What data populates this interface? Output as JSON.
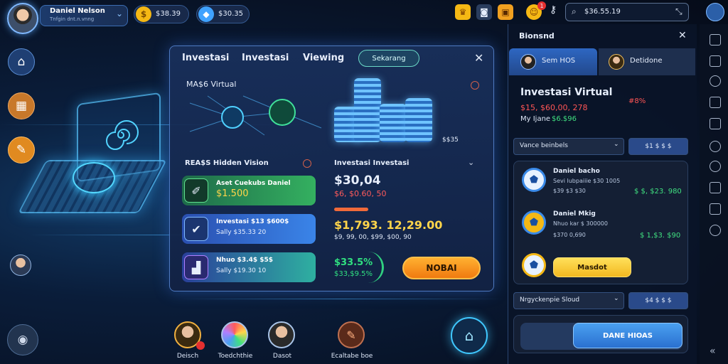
{
  "profile": {
    "name": "Daniel Nelson",
    "subtitle": "Tnfgin dnt.n.vnng",
    "avatar": "user-avatar"
  },
  "currency": {
    "gold": "$38.39",
    "gem": "$30.35"
  },
  "top_icons": [
    "trophy-icon",
    "camera-icon",
    "gift-icon",
    "notification-icon"
  ],
  "notification_badge": "1",
  "search": {
    "value": "$36.55.19"
  },
  "modal": {
    "tabs": [
      "Investasi",
      "Investasi",
      "Viewing"
    ],
    "active_tab": "Sekarang",
    "section_title": "MA$6 Virtual",
    "left_header": "REA$S Hidden Vision",
    "right_header": "Investasi Investasi",
    "cards": [
      {
        "title": "Aset Cuekubs Daniel",
        "sub": "$1.500",
        "icon": "wallet-icon"
      },
      {
        "title": "Investasi $13 $600$",
        "sub": "Sally $35.33 20",
        "icon": "shield-icon"
      },
      {
        "title": "Nhuo $3.4$ $5$",
        "sub": "Sally $19.30 10",
        "icon": "chart-icon"
      }
    ],
    "value_main": "$30,04",
    "value_sub": "$6, $0.60, 50",
    "value_big": "$1,793. 12,29.00",
    "value_big_sub": "$9, 99, 00, $99, $00, 90",
    "percent": "$33.5%",
    "percent_sub": "$33,$9.5%",
    "stack_label": "$$35",
    "buy_button": "NOBAI"
  },
  "right_panel": {
    "header": "Bionsnd",
    "tab_active": "Sem HOS",
    "tab_inactive": "Detidone",
    "title": "Investasi Virtual",
    "value": "$15, $60,00, 278",
    "value_badge": "#8%",
    "my_line": "My Ijane",
    "my_value": "$6.$96",
    "dropdown1": "Vance beinbels",
    "dropdown1_btn": "$1 $ $ $",
    "list": [
      {
        "title": "Daniel bacho",
        "sub": "Sevi lubpaiiie $30 1005",
        "date": "$39 $3 $30",
        "amount": "$ $, $23. 980",
        "icon": "shield-icon"
      },
      {
        "title": "Daniel Mkig",
        "sub": "Nhuo kar $ 300000",
        "date": "$370 0,690",
        "amount": "$ 1,$3. $90",
        "icon": "badge-icon"
      },
      {
        "title": "",
        "sub": "",
        "date": "",
        "amount": "",
        "icon": "shield-icon"
      }
    ],
    "list_button": "Masdot",
    "dropdown2": "Nrgyckenpie Sloud",
    "dropdown2_btn": "$4 $ $ $",
    "bottom_button": "DANE HIOAS"
  },
  "bottom_bar": [
    {
      "label": "Deisch"
    },
    {
      "label": "Toedchthie"
    },
    {
      "label": "Dasot"
    },
    {
      "label": "Ecaltabe boe"
    }
  ],
  "colors": {
    "accent": "#3b82f6",
    "positive": "#22e06b",
    "negative": "#ff4d4d",
    "gold": "#f5b814"
  }
}
